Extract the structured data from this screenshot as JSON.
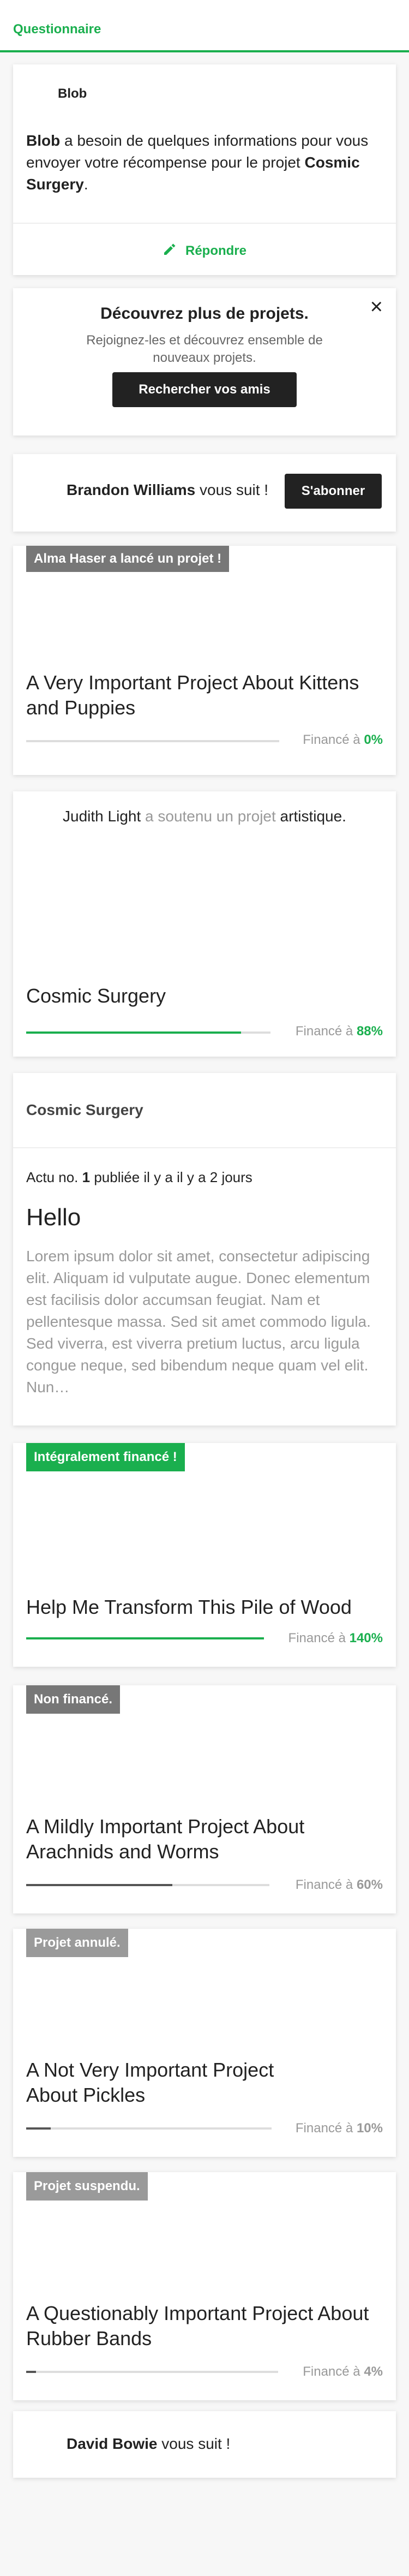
{
  "header": {
    "title": "Questionnaire"
  },
  "questionnaire": {
    "sender": "Blob",
    "message_sender": "Blob",
    "message_text": " a besoin de quelques informations pour vous envoyer votre récompense pour le projet ",
    "message_project": "Cosmic Surgery",
    "message_end": ".",
    "reply_label": "Répondre",
    "reply_icon": "pencil-icon"
  },
  "discover": {
    "title": "Découvrez plus de projets.",
    "subtitle": "Rejoignez-les et découvrez ensemble de nouveaux projets.",
    "button": "Rechercher vos amis",
    "close_icon": "×"
  },
  "follow_brandon": {
    "name": "Brandon Williams",
    "text": " vous suit !",
    "button": "S'abonner"
  },
  "activities": [
    {
      "badge": "Alma Haser a lancé un projet !",
      "title": "A Very Important Project About Kittens and Puppies",
      "funded_label": "Financé à ",
      "funded_pct": "0%",
      "progress": 0
    },
    {
      "backer": "Judith Light",
      "backed_text": " a soutenu un projet ",
      "category": "artistique",
      "end": ".",
      "title": "Cosmic Surgery",
      "funded_label": "Financé à ",
      "funded_pct": "88%",
      "progress": 0.88
    }
  ],
  "news": {
    "project": "Cosmic Surgery",
    "update_label": "Actu no. ",
    "update_number": "1",
    "update_time": " publiée il y a il y a 2 jours",
    "title": "Hello",
    "body": "Lorem ipsum dolor sit amet, consectetur adipiscing elit. Aliquam id vulputate augue. Donec elementum est facilisis dolor accumsan feugiat. Nam et pellentesque massa. Sed sit amet commodo ligula. Sed viverra, est viverra pretium luctus, arcu ligula congue neque, sed bibendum neque quam vel elit. Nun…"
  },
  "projects": [
    {
      "badge": "Intégralement financé !",
      "title": "Help Me Transform This Pile of Wood",
      "funded_label": "Financé à ",
      "funded_pct": "140%",
      "progress": 1.0,
      "state": "success"
    },
    {
      "badge": "Non financé.",
      "title": "A Mildly Important Project About Arachnids and Worms",
      "funded_label": "Financé à ",
      "funded_pct": "60%",
      "progress": 0.6,
      "state": "failed"
    },
    {
      "badge": "Projet annulé.",
      "title": "A Not Very Important Project About Pickles",
      "funded_label": "Financé à ",
      "funded_pct": "10%",
      "progress": 0.1,
      "state": "canceled"
    },
    {
      "badge": "Projet suspendu.",
      "title": "A Questionably Important Project About Rubber Bands",
      "funded_label": "Financé à ",
      "funded_pct": "4%",
      "progress": 0.04,
      "state": "suspended"
    }
  ],
  "follow_david": {
    "name": "David Bowie",
    "text": " vous suit !"
  },
  "colors": {
    "accent": "#1aaf4e",
    "dark": "#222222",
    "muted": "#999999",
    "badge": "#777777"
  }
}
